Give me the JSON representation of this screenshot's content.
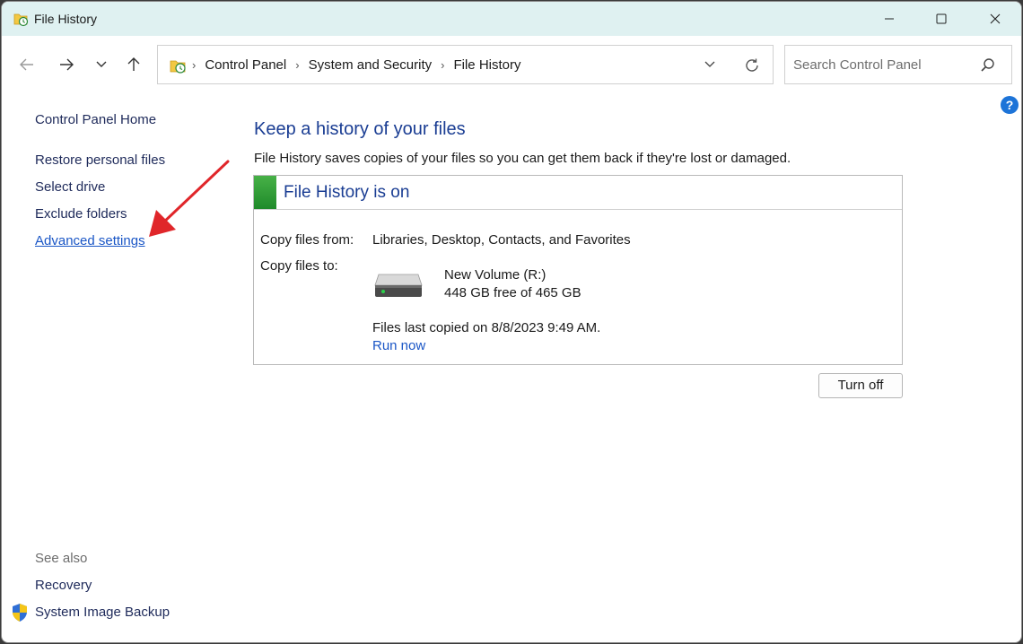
{
  "window": {
    "title": "File History"
  },
  "address_bar": {
    "crumbs": [
      "Control Panel",
      "System and Security",
      "File History"
    ]
  },
  "search": {
    "placeholder": "Search Control Panel"
  },
  "left_pane": {
    "home": "Control Panel Home",
    "links": [
      "Restore personal files",
      "Select drive",
      "Exclude folders",
      "Advanced settings"
    ],
    "see_also_label": "See also",
    "see_also": [
      "Recovery",
      "System Image Backup"
    ]
  },
  "main": {
    "title": "Keep a history of your files",
    "description": "File History saves copies of your files so you can get them back if they're lost or damaged.",
    "status": "File History is on",
    "copy_from_label": "Copy files from:",
    "copy_from_value": "Libraries, Desktop, Contacts, and Favorites",
    "copy_to_label": "Copy files to:",
    "drive_name": "New Volume (R:)",
    "drive_space": "448 GB free of 465 GB",
    "last_copied": "Files last copied on 8/8/2023 9:49 AM.",
    "run_now": "Run now",
    "turn_off": "Turn off"
  },
  "colors": {
    "titlebar": "#dff1f1",
    "heading": "#1a3d93",
    "link": "#1a56c6",
    "status_green": "#2e9c34",
    "annotation_arrow": "#e0262a"
  }
}
